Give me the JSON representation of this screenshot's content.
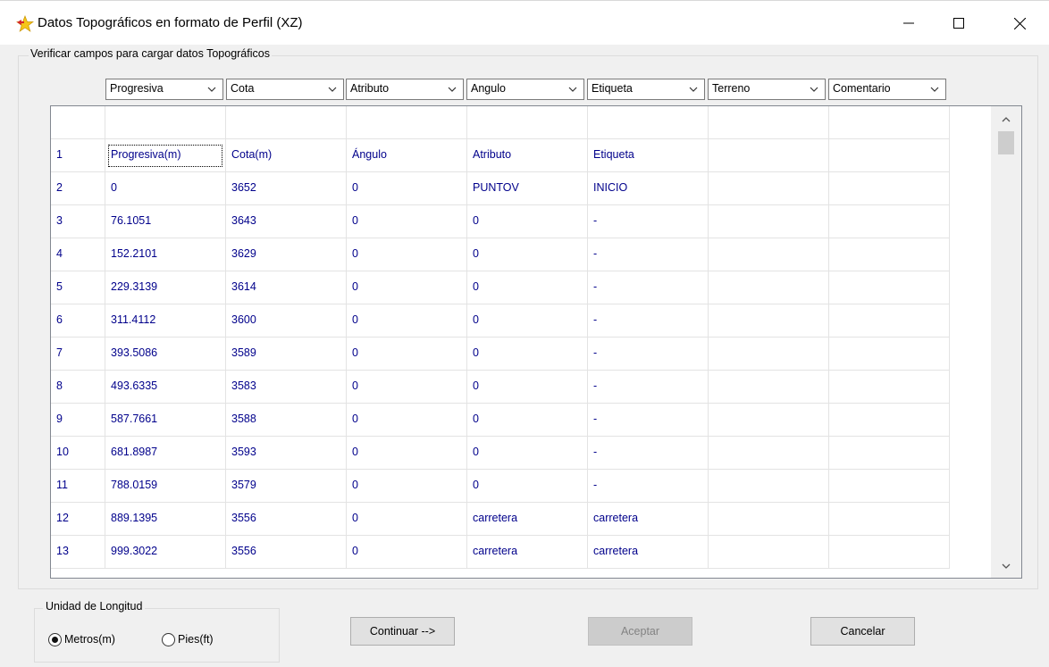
{
  "window": {
    "title": "Datos Topográficos en formato de Perfil (XZ)"
  },
  "group": {
    "caption": "Verificar campos para cargar datos Topográficos"
  },
  "columns": [
    {
      "selected": "Progresiva"
    },
    {
      "selected": "Cota"
    },
    {
      "selected": "Atributo"
    },
    {
      "selected": "Angulo"
    },
    {
      "selected": "Etiqueta"
    },
    {
      "selected": "Terreno"
    },
    {
      "selected": "Comentario"
    }
  ],
  "grid": {
    "rows": [
      {
        "num": "",
        "cells": [
          "",
          "",
          "",
          "",
          "",
          "",
          ""
        ]
      },
      {
        "num": "1",
        "cells": [
          "Progresiva(m)",
          "Cota(m)",
          "Ángulo",
          "Atributo",
          "Etiqueta",
          "",
          ""
        ]
      },
      {
        "num": "2",
        "cells": [
          "0",
          "3652",
          "0",
          "PUNTOV",
          "INICIO",
          "",
          ""
        ]
      },
      {
        "num": "3",
        "cells": [
          "76.1051",
          "3643",
          "0",
          "0",
          "-",
          "",
          ""
        ]
      },
      {
        "num": "4",
        "cells": [
          "152.2101",
          "3629",
          "0",
          "0",
          "-",
          "",
          ""
        ]
      },
      {
        "num": "5",
        "cells": [
          "229.3139",
          "3614",
          "0",
          "0",
          "-",
          "",
          ""
        ]
      },
      {
        "num": "6",
        "cells": [
          "311.4112",
          "3600",
          "0",
          "0",
          "-",
          "",
          ""
        ]
      },
      {
        "num": "7",
        "cells": [
          "393.5086",
          "3589",
          "0",
          "0",
          "-",
          "",
          ""
        ]
      },
      {
        "num": "8",
        "cells": [
          "493.6335",
          "3583",
          "0",
          "0",
          "-",
          "",
          ""
        ]
      },
      {
        "num": "9",
        "cells": [
          "587.7661",
          "3588",
          "0",
          "0",
          "-",
          "",
          ""
        ]
      },
      {
        "num": "10",
        "cells": [
          "681.8987",
          "3593",
          "0",
          "0",
          "-",
          "",
          ""
        ]
      },
      {
        "num": "11",
        "cells": [
          "788.0159",
          "3579",
          "0",
          "0",
          "-",
          "",
          ""
        ]
      },
      {
        "num": "12",
        "cells": [
          "889.1395",
          "3556",
          "0",
          "carretera",
          "carretera",
          "",
          ""
        ]
      },
      {
        "num": "13",
        "cells": [
          "999.3022",
          "3556",
          "0",
          "carretera",
          "carretera",
          "",
          ""
        ]
      }
    ]
  },
  "units": {
    "caption": "Unidad de Longitud",
    "options": [
      {
        "label": "Metros(m)",
        "selected": true
      },
      {
        "label": "Pies(ft)",
        "selected": false
      }
    ]
  },
  "buttons": {
    "continue": "Continuar -->",
    "accept": "Aceptar",
    "cancel": "Cancelar"
  },
  "icons": {
    "app": "star-arrow-icon",
    "minimize": "minimize-icon",
    "maximize": "maximize-icon",
    "close": "close-icon",
    "dropdown": "chevron-down-icon",
    "scroll_up": "chevron-up-icon",
    "scroll_down": "chevron-down-icon"
  },
  "colors": {
    "cell_text": "#00008b",
    "disabled_button": "#cccccc"
  }
}
